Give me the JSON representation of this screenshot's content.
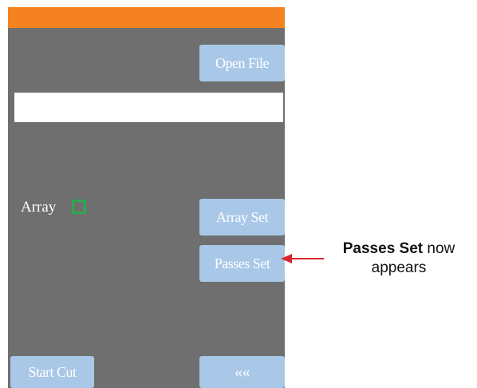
{
  "device": {
    "file_path": "",
    "open_file_label": "Open File",
    "array_label": "Array",
    "array_checked": false,
    "array_set_label": "Array Set",
    "passes_set_label": "Passes Set",
    "start_cut_label": "Start Cut",
    "back_label": "««"
  },
  "callout": {
    "bold_text": "Passes Set",
    "rest_line1": " now",
    "line2": "appears"
  },
  "colors": {
    "top_bar": "#f58220",
    "panel": "#6f6f6f",
    "button": "#a9c8e8",
    "checkbox_border": "#2fa84f",
    "arrow": "#d7282f"
  },
  "icons": {
    "back": "double-chevron-left-icon",
    "pointer": "arrow-left-icon"
  }
}
